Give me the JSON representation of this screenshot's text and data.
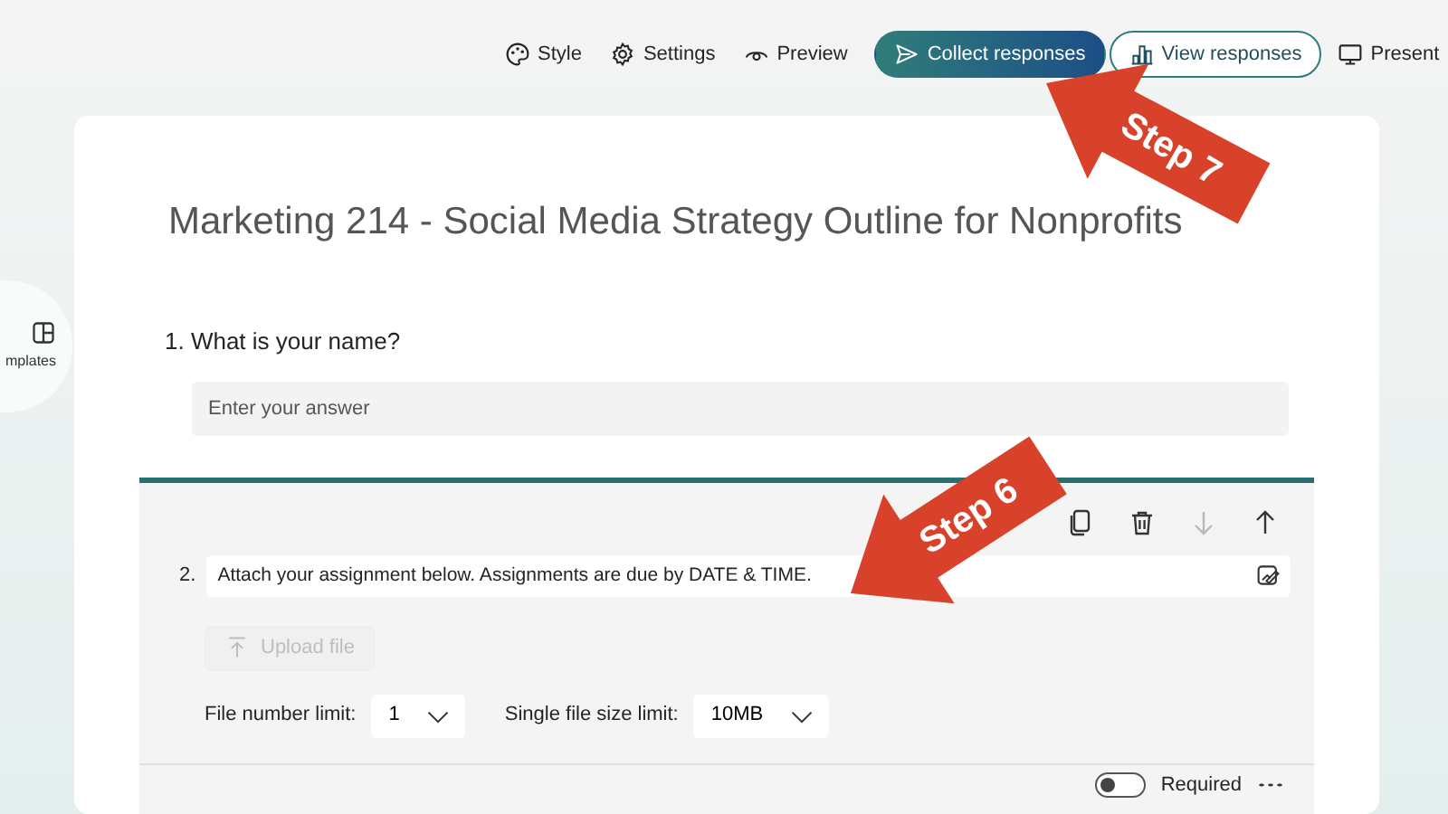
{
  "toolbar": {
    "items": [
      {
        "label": "Style",
        "kind": "plain"
      },
      {
        "label": "Settings",
        "kind": "plain"
      },
      {
        "label": "Preview",
        "kind": "plain"
      },
      {
        "label": "Collect responses",
        "kind": "primary"
      },
      {
        "label": "View responses",
        "kind": "outline"
      },
      {
        "label": "Present",
        "kind": "plain"
      }
    ]
  },
  "sidebar": {
    "items": [
      {
        "label": "mplates"
      }
    ]
  },
  "form": {
    "title": "Marketing 214 - Social Media Strategy Outline for Nonprofits",
    "question_1": {
      "text": "1. What is your name?",
      "placeholder": "Enter your answer"
    },
    "question_2": {
      "actions": [
        {
          "kind": "copy",
          "disabled": false
        },
        {
          "kind": "delete",
          "disabled": false
        },
        {
          "kind": "move-down",
          "disabled": true
        },
        {
          "kind": "move-up",
          "disabled": false
        }
      ],
      "number": "2.",
      "value": "Attach your assignment below. Assignments are due by DATE & TIME.",
      "upload": {
        "label": "Upload file",
        "disabled": true
      },
      "limits": [
        {
          "label": "File number limit:",
          "value": "1"
        },
        {
          "label": "Single file size limit:",
          "value": "10MB"
        }
      ],
      "required": {
        "label": "Required",
        "on": false
      }
    }
  },
  "annotations": [
    {
      "label": "Step 7"
    },
    {
      "label": "Step 6"
    }
  ]
}
